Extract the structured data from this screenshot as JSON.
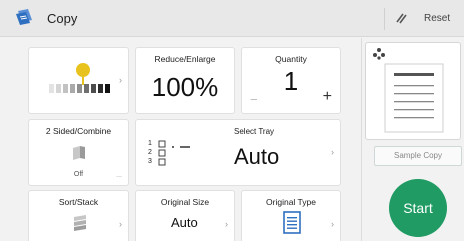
{
  "header": {
    "title": "Copy",
    "app_icon": "copy-app-icon",
    "reset_label": "Reset",
    "reset_icon": "reset-icon"
  },
  "tiles": {
    "density": {
      "icon": "density-scale-icon",
      "level_fraction": 0.75
    },
    "reduce_enlarge": {
      "title": "Reduce/Enlarge",
      "value": "100%"
    },
    "quantity": {
      "title": "Quantity",
      "value": "1",
      "minus": "−",
      "plus": "+"
    },
    "two_sided": {
      "title": "2 Sided/Combine",
      "status": "Off",
      "more": "..."
    },
    "select_tray": {
      "title": "Select Tray",
      "value": "Auto",
      "trays": [
        "1",
        "2",
        "3"
      ]
    },
    "sort_stack": {
      "title": "Sort/Stack"
    },
    "original_size": {
      "title": "Original Size",
      "value": "Auto"
    },
    "original_type": {
      "title": "Original Type"
    }
  },
  "right_panel": {
    "sample_copy_label": "Sample Copy",
    "start_label": "Start"
  },
  "colors": {
    "accent_yellow": "#e8c21d",
    "start_green": "#1f9b63",
    "icon_blue": "#2f6fbf"
  }
}
